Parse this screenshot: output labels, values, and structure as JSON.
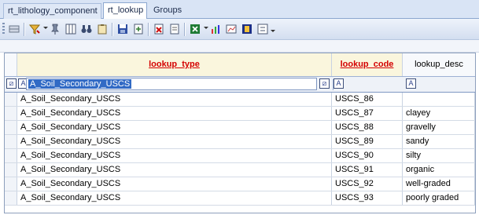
{
  "tabs": [
    "rt_lithology_component",
    "rt_lookup",
    "Groups"
  ],
  "toolbar": {
    "icons": [
      "table-icon",
      "filter-icon",
      "filter-dropdown",
      "pin-icon",
      "columns-icon",
      "binoculars-icon",
      "clipboard-icon",
      "save-icon",
      "export-icon",
      "delete-icon",
      "refresh-icon",
      "excel-icon",
      "excel-dropdown",
      "chart-icon",
      "report-icon",
      "form-icon",
      "settings-icon",
      "overflow-dropdown"
    ]
  },
  "grid": {
    "columns": [
      {
        "key": "lookup_type",
        "label": "lookup_type"
      },
      {
        "key": "lookup_code",
        "label": "lookup_code"
      },
      {
        "key": "lookup_desc",
        "label": "lookup_desc"
      }
    ],
    "filter": {
      "lookup_type": "A_Soil_Secondary_USCS",
      "lookup_code": "",
      "lookup_desc": ""
    },
    "rows": [
      [
        "A_Soil_Secondary_USCS",
        "USCS_86",
        ""
      ],
      [
        "A_Soil_Secondary_USCS",
        "USCS_87",
        "clayey"
      ],
      [
        "A_Soil_Secondary_USCS",
        "USCS_88",
        "gravelly"
      ],
      [
        "A_Soil_Secondary_USCS",
        "USCS_89",
        "sandy"
      ],
      [
        "A_Soil_Secondary_USCS",
        "USCS_90",
        "silty"
      ],
      [
        "A_Soil_Secondary_USCS",
        "USCS_91",
        "organic"
      ],
      [
        "A_Soil_Secondary_USCS",
        "USCS_92",
        "well-graded"
      ],
      [
        "A_Soil_Secondary_USCS",
        "USCS_93",
        "poorly graded"
      ]
    ]
  },
  "colors": {
    "sort_header": "#d40000",
    "selection": "#316ac5",
    "tab_bg": "#d9e4f5"
  }
}
